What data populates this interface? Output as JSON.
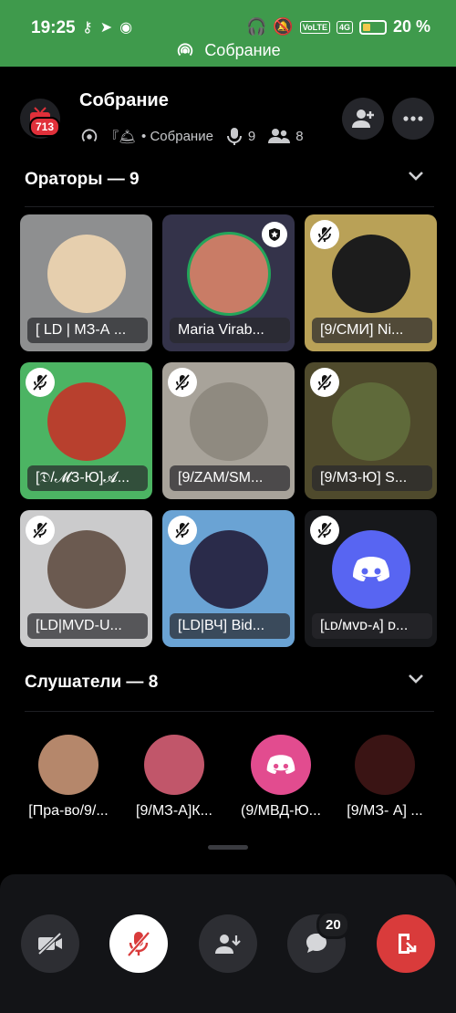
{
  "status_bar": {
    "time": "19:25",
    "battery": "20 %",
    "volte": "VoLTE",
    "network": "4G",
    "call_label": "Собрание"
  },
  "header": {
    "title": "Собрание",
    "unread_badge": "713",
    "subtitle_prefix": "『🛎",
    "subtitle_channel": "• Собрание",
    "speakers_count": "9",
    "members_count": "8"
  },
  "speakers_section": {
    "title": "Ораторы — 9",
    "tiles": [
      {
        "name": "[ LD | МЗ-А ...",
        "bg": "#8e8f90",
        "avatar_color": "#e6cfae",
        "muted": false,
        "star": false
      },
      {
        "name": "Maria Virab...",
        "bg": "#34334a",
        "avatar_color": "#c97c66",
        "muted": false,
        "star": true
      },
      {
        "name": "[9/СМИ] Ni...",
        "bg": "#b9a157",
        "avatar_color": "#1c1c1c",
        "muted": true,
        "star": false
      },
      {
        "name": "[𝔇/𝓜З-Ю]𝓐...",
        "bg": "#4cb463",
        "avatar_color": "#b8402e",
        "muted": true,
        "star": false
      },
      {
        "name": "[9/ZAM/SM...",
        "bg": "#a8a39a",
        "avatar_color": "#8f8a80",
        "muted": true,
        "star": false
      },
      {
        "name": "[9/МЗ-Ю] S...",
        "bg": "#4f4a2c",
        "avatar_color": "#5f6a3a",
        "muted": true,
        "star": false
      },
      {
        "name": "[LD|MVD-U...",
        "bg": "#cbcbcc",
        "avatar_color": "#6b5a50",
        "muted": true,
        "star": false
      },
      {
        "name": "[LD|ВЧ] Bid...",
        "bg": "#6aa3d4",
        "avatar_color": "#2a2b4a",
        "muted": true,
        "star": false
      },
      {
        "name": "[ʟᴅ/ᴍᴠᴅ-ᴀ] ᴅ...",
        "bg": "#17181b",
        "avatar_color": "#5865f2",
        "muted": true,
        "star": false
      }
    ]
  },
  "listeners_section": {
    "title": "Слушатели — 8",
    "items": [
      {
        "name": "[Пра-во/9/...",
        "avatar_color": "#b5876b"
      },
      {
        "name": "[9/МЗ-А]К...",
        "avatar_color": "#c1566a"
      },
      {
        "name": "(9/МВД-Ю...",
        "avatar_color": "#e24c8f"
      },
      {
        "name": "[9/МЗ- А] ...",
        "avatar_color": "#3a1414"
      }
    ]
  },
  "controls": {
    "chat_badge": "20"
  },
  "colors": {
    "status_green": "#3f9a4c",
    "leave_red": "#d93b3b",
    "discord_blurple": "#5865f2"
  }
}
